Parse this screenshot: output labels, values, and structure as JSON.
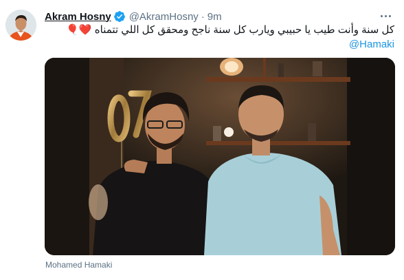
{
  "tweet": {
    "display_name": "Akram Hosny",
    "handle": "@AkramHosny",
    "separator": "·",
    "time": "9m",
    "text": "كل سنة وأنت طيب يا حبيبي ويارب كل سنة ناجح ومحقق كل اللي تتمناه",
    "emojis": "❤️🎈",
    "mention": "@Hamaki",
    "tagged_user": "Mohamed Hamaki"
  },
  "icons": {
    "verified": "verified-badge-icon",
    "more": "more-options-icon"
  },
  "colors": {
    "link": "#1b95e0",
    "verified": "#1da1f2",
    "secondary_text": "#5b7083",
    "heart": "#e0245e"
  }
}
